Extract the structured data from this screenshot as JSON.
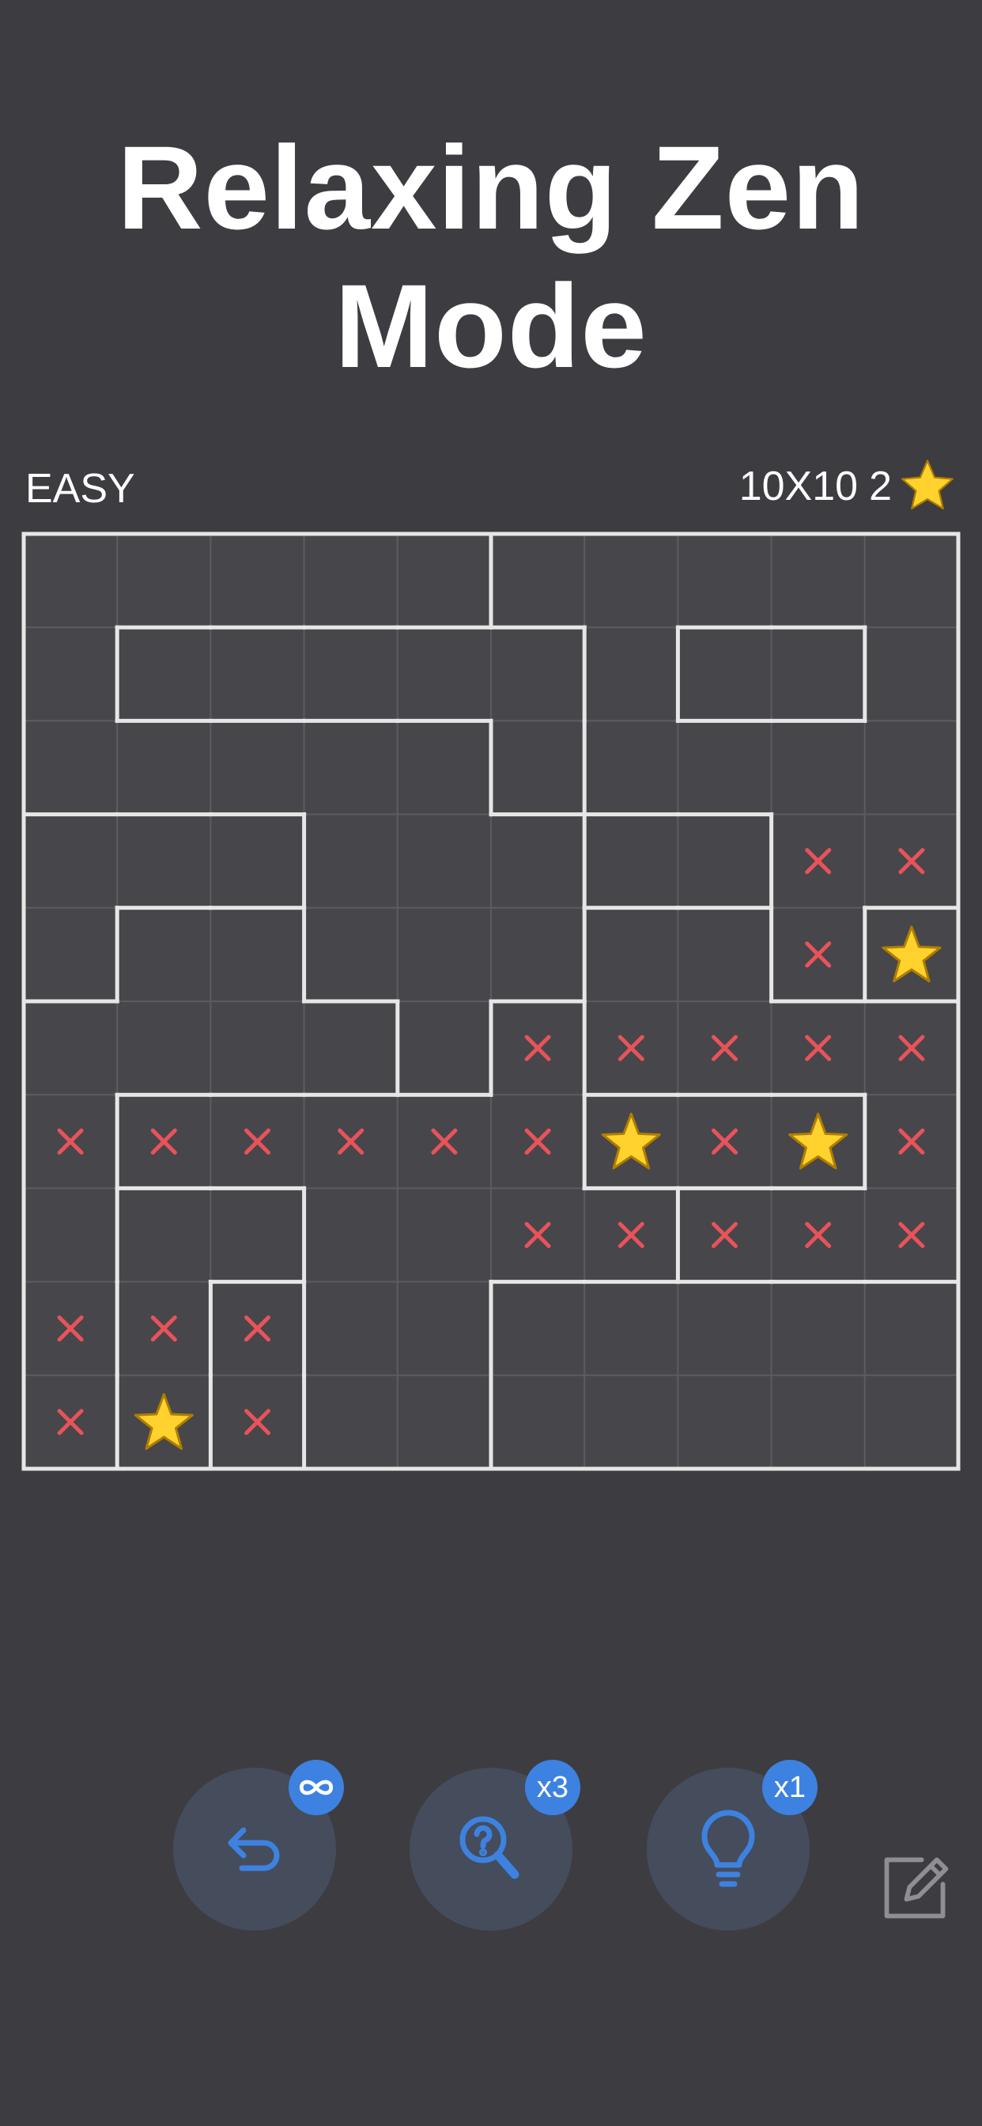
{
  "header": {
    "title_line1": "Relaxing Zen",
    "title_line2": "Mode"
  },
  "info_bar": {
    "difficulty": "EASY",
    "grid_size": "10X10",
    "stars_per_region": "2",
    "star_icon": "star-icon"
  },
  "colors": {
    "background": "#3d3c41",
    "cell": "#47464b",
    "grid_line": "#5c5b61",
    "region_border": "#e6e6e6",
    "star_fill": "#ffd22e",
    "star_stroke": "#b07d00",
    "x_mark": "#e8535a",
    "tool_bg": "#454c5c",
    "accent": "#3d82e0"
  },
  "board": {
    "rows": 10,
    "cols": 10,
    "regions": [
      [
        0,
        0,
        0,
        0,
        0,
        1,
        1,
        1,
        1,
        1
      ],
      [
        0,
        2,
        2,
        2,
        2,
        2,
        1,
        3,
        3,
        1
      ],
      [
        0,
        0,
        0,
        0,
        0,
        2,
        1,
        1,
        1,
        1
      ],
      [
        4,
        4,
        4,
        0,
        0,
        0,
        5,
        5,
        1,
        1
      ],
      [
        4,
        6,
        6,
        0,
        0,
        0,
        7,
        7,
        1,
        8
      ],
      [
        6,
        6,
        6,
        6,
        0,
        9,
        7,
        7,
        7,
        7
      ],
      [
        6,
        9,
        9,
        9,
        9,
        9,
        10,
        10,
        10,
        7
      ],
      [
        6,
        11,
        11,
        9,
        9,
        9,
        9,
        7,
        7,
        7
      ],
      [
        6,
        11,
        12,
        9,
        9,
        13,
        13,
        13,
        13,
        13
      ],
      [
        6,
        11,
        12,
        9,
        9,
        13,
        13,
        13,
        13,
        13
      ]
    ],
    "cells": [
      [
        "",
        "",
        "",
        "",
        "",
        "",
        "",
        "",
        "",
        ""
      ],
      [
        "",
        "",
        "",
        "",
        "",
        "",
        "",
        "",
        "",
        ""
      ],
      [
        "",
        "",
        "",
        "",
        "",
        "",
        "",
        "",
        "",
        ""
      ],
      [
        "",
        "",
        "",
        "",
        "",
        "",
        "",
        "",
        "x",
        "x"
      ],
      [
        "",
        "",
        "",
        "",
        "",
        "",
        "",
        "",
        "x",
        "star"
      ],
      [
        "",
        "",
        "",
        "",
        "",
        "x",
        "x",
        "x",
        "x",
        "x"
      ],
      [
        "x",
        "x",
        "x",
        "x",
        "x",
        "x",
        "star",
        "x",
        "star",
        "x"
      ],
      [
        "",
        "",
        "",
        "",
        "",
        "x",
        "x",
        "x",
        "x",
        "x"
      ],
      [
        "x",
        "x",
        "x",
        "",
        "",
        "",
        "",
        "",
        "",
        ""
      ],
      [
        "x",
        "star",
        "x",
        "",
        "",
        "",
        "",
        "",
        "",
        ""
      ]
    ]
  },
  "tools": {
    "undo": {
      "icon": "undo-icon",
      "badge_icon": "infinity-icon"
    },
    "hint": {
      "icon": "magnifier-question-icon",
      "badge": "x3"
    },
    "reveal": {
      "icon": "lightbulb-icon",
      "badge": "x1"
    },
    "edit": {
      "icon": "edit-icon"
    }
  }
}
